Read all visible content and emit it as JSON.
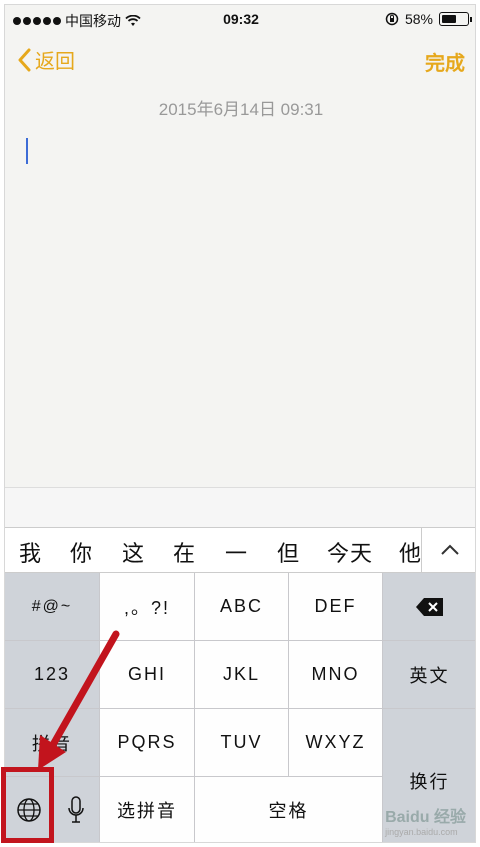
{
  "status_bar": {
    "carrier": "中国移动",
    "time": "09:32",
    "battery_percent": "58%",
    "battery_level": 0.58,
    "wifi_icon": "wifi-icon",
    "lock_icon": "orientation-lock-icon"
  },
  "nav": {
    "back_label": "返回",
    "done_label": "完成",
    "accent_color": "#e6a81c"
  },
  "note": {
    "date": "2015年6月14日 09:31",
    "body": ""
  },
  "candidates": {
    "items": [
      "我",
      "你",
      "这",
      "在",
      "一",
      "但",
      "今天",
      "他"
    ],
    "collapse_icon": "chevron-up-icon",
    "collapse_label": "^"
  },
  "keyboard": {
    "symbols": "#@~",
    "punct": ",。?!",
    "abc": "ABC",
    "def": "DEF",
    "delete_icon": "backspace-icon",
    "num": "123",
    "ghi": "GHI",
    "jkl": "JKL",
    "mno": "MNO",
    "english": "英文",
    "pinyin": "拼音",
    "pqrs": "PQRS",
    "tuv": "TUV",
    "wxyz": "WXYZ",
    "return": "换行",
    "globe_icon": "globe-icon",
    "mic_icon": "microphone-icon",
    "select_pinyin": "选拼音",
    "space": "空格"
  },
  "watermark": {
    "text": "Baidu 经验",
    "url": "jingyan.baidu.com"
  },
  "annotation_color": "#c2141d"
}
